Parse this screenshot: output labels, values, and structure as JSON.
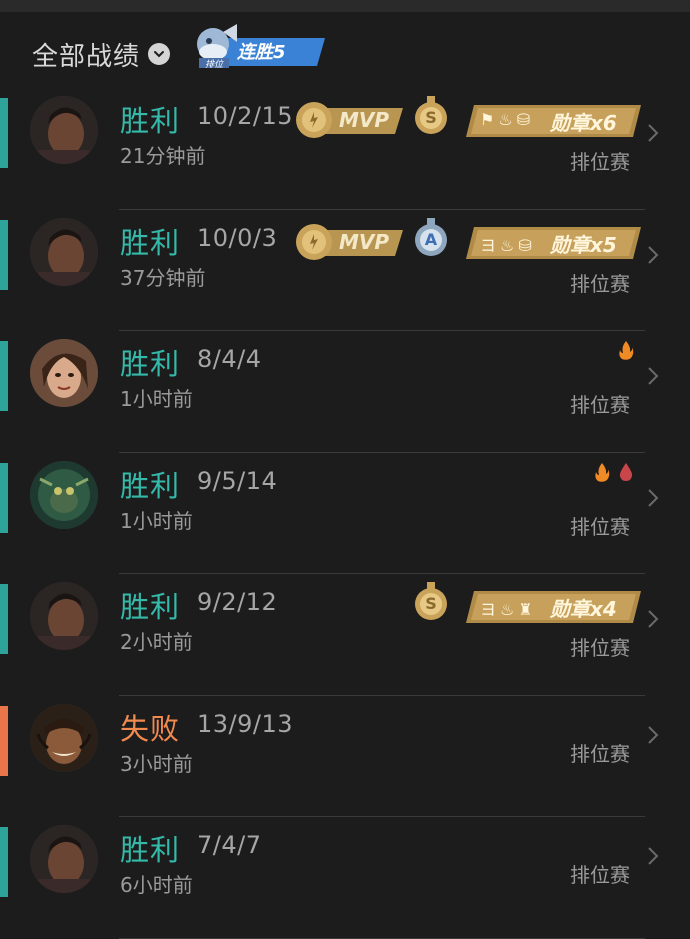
{
  "header": {
    "title": "全部战绩",
    "streak_rank_label": "排位",
    "streak_label": "连胜5"
  },
  "matches": [
    {
      "result": "胜利",
      "kda": "10/2/15",
      "time": "21分钟前",
      "mode": "排位赛",
      "mvp": "MVP",
      "medal": "S",
      "honor": "勋章x6"
    },
    {
      "result": "胜利",
      "kda": "10/0/3",
      "time": "37分钟前",
      "mode": "排位赛",
      "mvp": "MVP",
      "medal": "A",
      "honor": "勋章x5"
    },
    {
      "result": "胜利",
      "kda": "8/4/4",
      "time": "1小时前",
      "mode": "排位赛"
    },
    {
      "result": "胜利",
      "kda": "9/5/14",
      "time": "1小时前",
      "mode": "排位赛"
    },
    {
      "result": "胜利",
      "kda": "9/2/12",
      "time": "2小时前",
      "mode": "排位赛",
      "medal": "S",
      "honor": "勋章x4"
    },
    {
      "result": "失败",
      "kda": "13/9/13",
      "time": "3小时前",
      "mode": "排位赛"
    },
    {
      "result": "胜利",
      "kda": "7/4/7",
      "time": "6小时前",
      "mode": "排位赛"
    }
  ],
  "colors": {
    "win": "#35b9a9",
    "loss": "#f18a4f",
    "background": "#1c1c1d",
    "gold": "#c9a35a"
  },
  "icons": {
    "fire": "fire-icon",
    "blood": "blood-drop-icon",
    "chevron": "chevron-right-icon"
  }
}
